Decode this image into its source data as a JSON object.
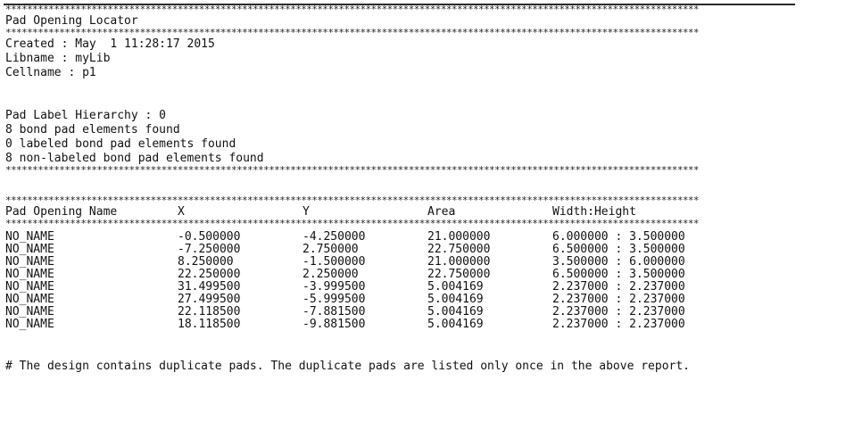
{
  "rule": "*********************************************************************************************************************************",
  "title": "Pad Opening Locator",
  "created": "Created : May  1 11:28:17 2015",
  "libname": "Libname : myLib",
  "cellname": "Cellname : p1",
  "hierarchy": "Pad Label Hierarchy : 0",
  "found_bond": "8 bond pad elements found",
  "found_labeled": "0 labeled bond pad elements found",
  "found_nonlabeled": "8 non-labeled bond pad elements found",
  "table": {
    "headers": [
      "Pad Opening Name",
      "X",
      "Y",
      "Area",
      "Width:Height"
    ],
    "rows": [
      {
        "name": "NO_NAME",
        "x": "-0.500000",
        "y": "-4.250000",
        "area": "21.000000",
        "wh": "6.000000 : 3.500000"
      },
      {
        "name": "NO_NAME",
        "x": "-7.250000",
        "y": "2.750000",
        "area": "22.750000",
        "wh": "6.500000 : 3.500000"
      },
      {
        "name": "NO_NAME",
        "x": "8.250000",
        "y": "-1.500000",
        "area": "21.000000",
        "wh": "3.500000 : 6.000000"
      },
      {
        "name": "NO_NAME",
        "x": "22.250000",
        "y": "2.250000",
        "area": "22.750000",
        "wh": "6.500000 : 3.500000"
      },
      {
        "name": "NO_NAME",
        "x": "31.499500",
        "y": "-3.999500",
        "area": "5.004169",
        "wh": "2.237000 : 2.237000"
      },
      {
        "name": "NO_NAME",
        "x": "27.499500",
        "y": "-5.999500",
        "area": "5.004169",
        "wh": "2.237000 : 2.237000"
      },
      {
        "name": "NO_NAME",
        "x": "22.118500",
        "y": "-7.881500",
        "area": "5.004169",
        "wh": "2.237000 : 2.237000"
      },
      {
        "name": "NO_NAME",
        "x": "18.118500",
        "y": "-9.881500",
        "area": "5.004169",
        "wh": "2.237000 : 2.237000"
      }
    ]
  },
  "footnote": "# The design contains duplicate pads. The duplicate pads are listed only once in the above report."
}
